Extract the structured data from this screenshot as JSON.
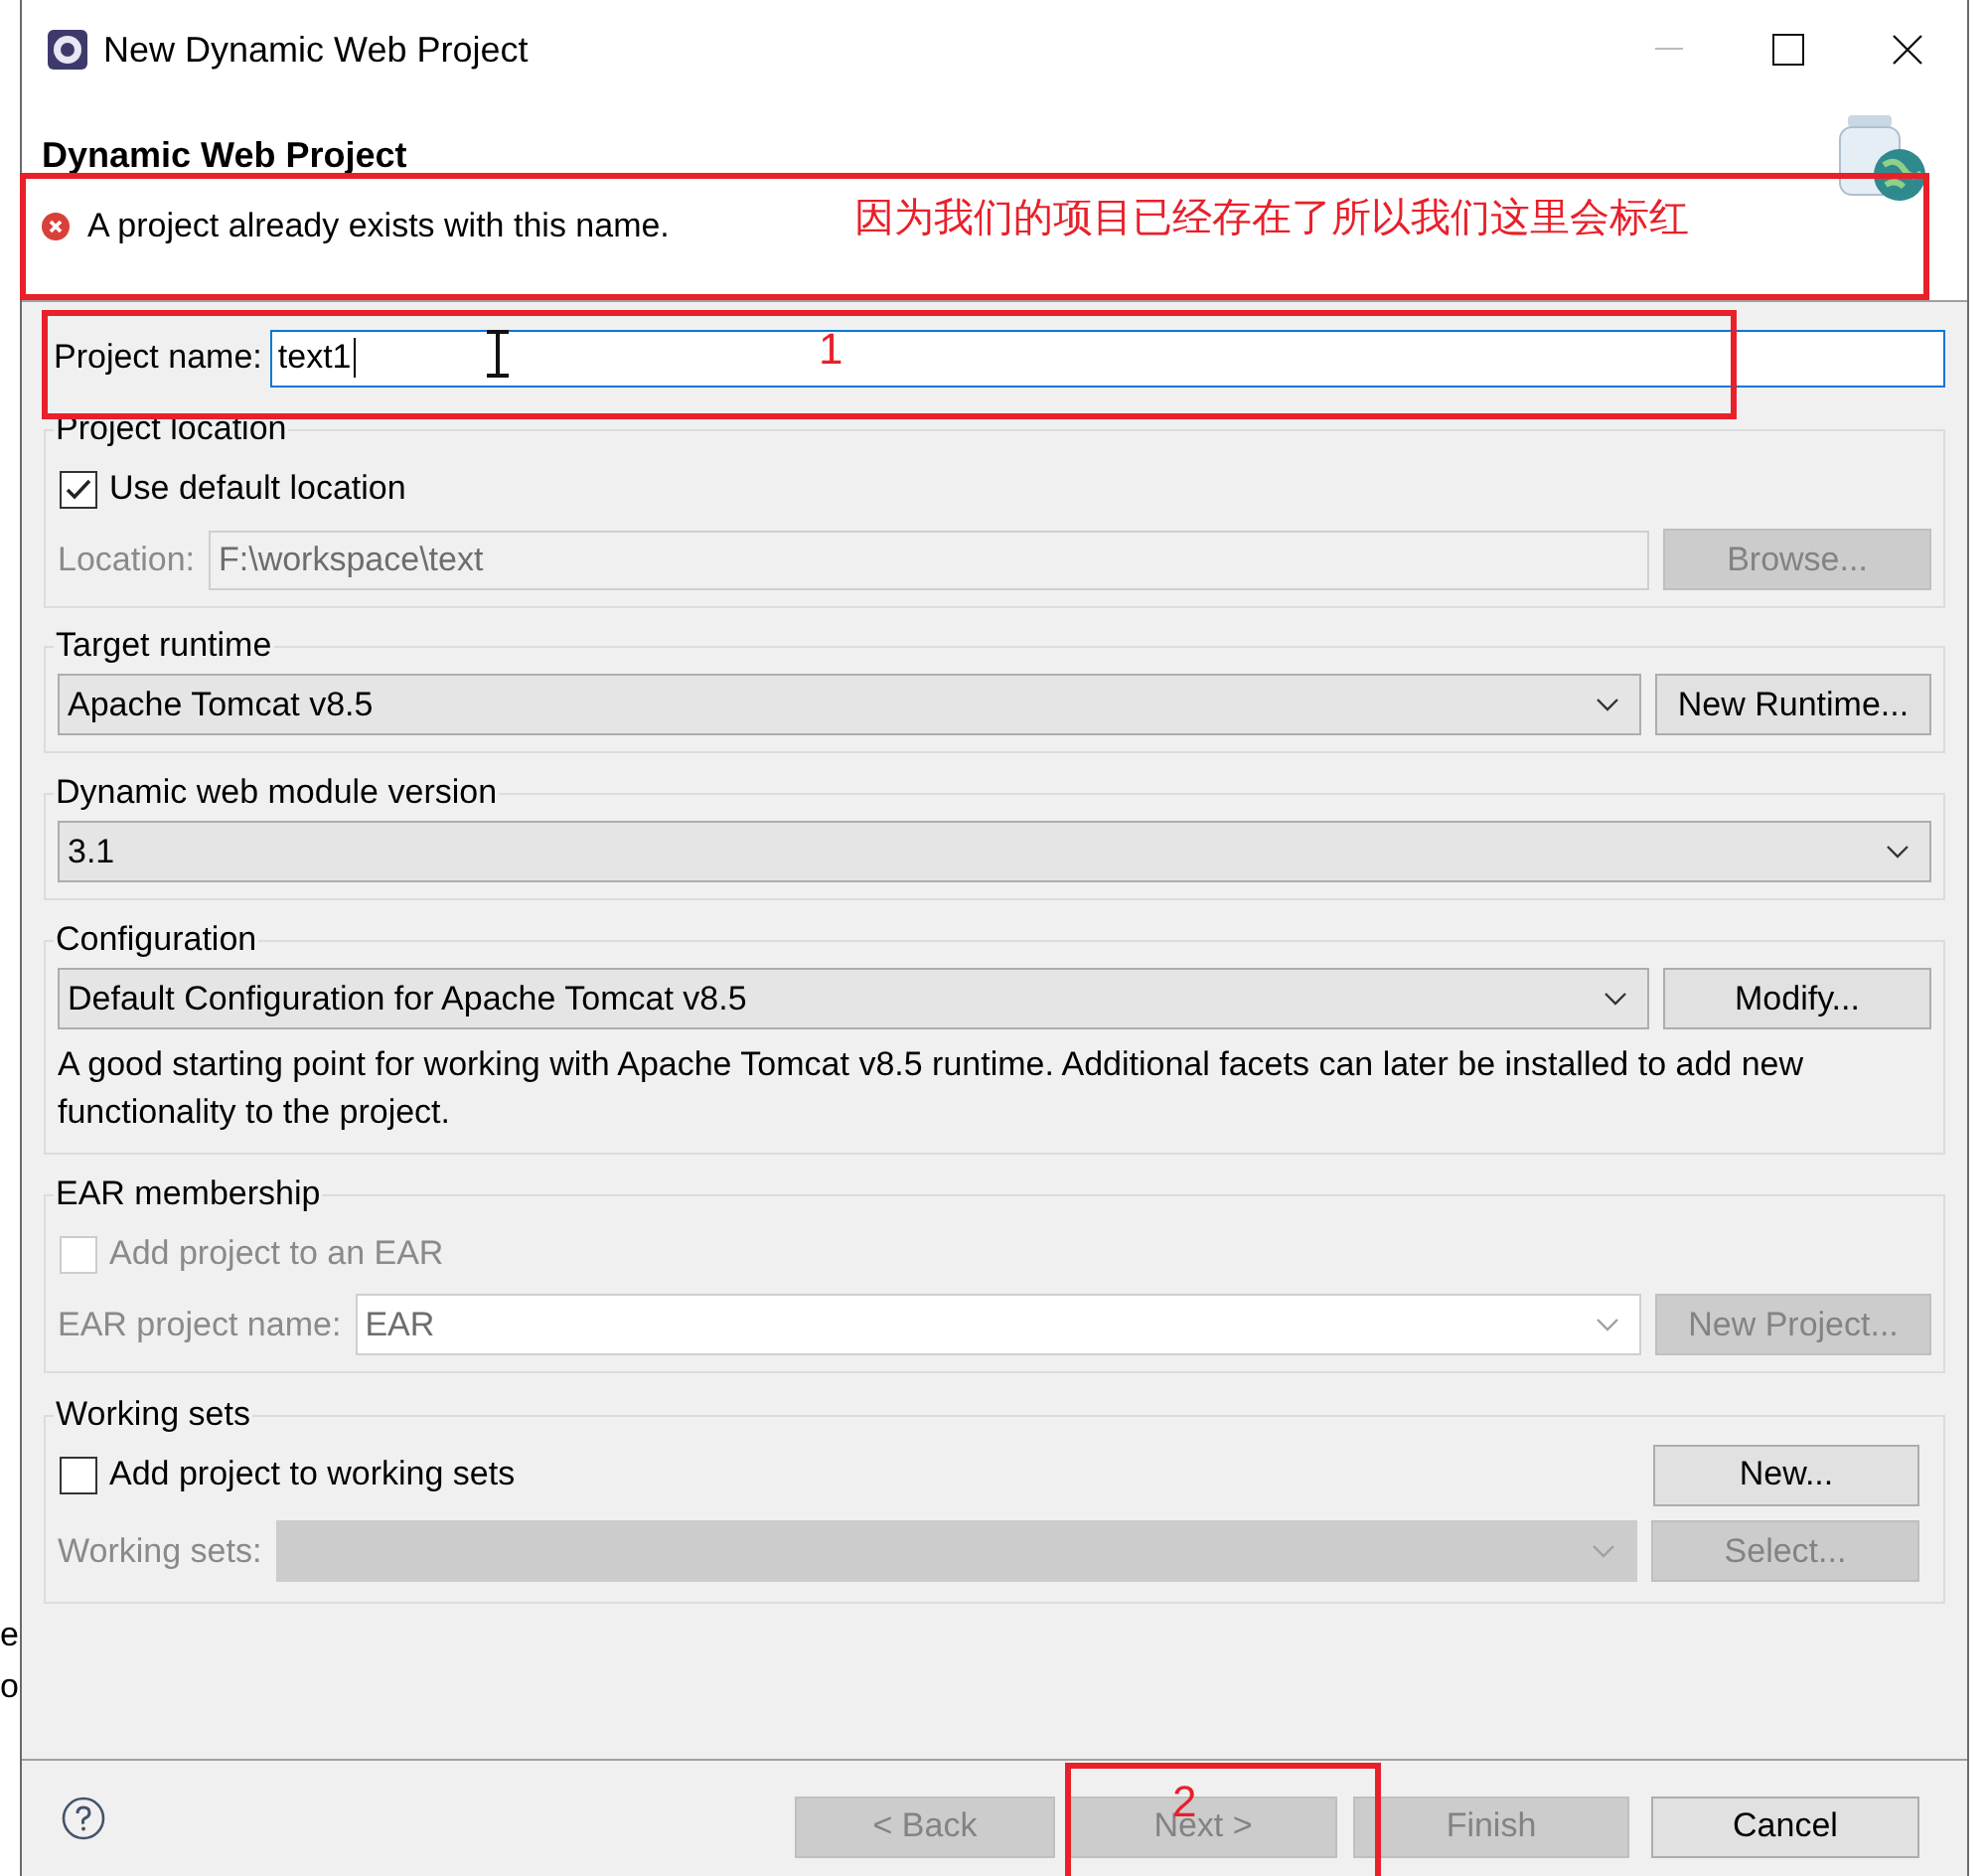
{
  "window": {
    "title": "New Dynamic Web Project"
  },
  "header": {
    "title": "Dynamic Web Project",
    "message": {
      "kind": "error",
      "text": "A project already exists with this name."
    }
  },
  "project_name": {
    "label": "Project name:",
    "value": "text1"
  },
  "sections": [
    {
      "title": "Project location",
      "rows": [
        {
          "kind": "checkbox",
          "label": "Use default location",
          "checked": true,
          "disabled": false
        },
        {
          "kind": "field",
          "label": "Location:",
          "value": "F:\\workspace\\text",
          "disabled": true,
          "button": {
            "label": "Browse...",
            "disabled": true
          }
        }
      ]
    },
    {
      "title": "Target runtime",
      "rows": [
        {
          "kind": "combo",
          "value": "Apache Tomcat v8.5",
          "disabled": false,
          "button": {
            "label": "New Runtime...",
            "disabled": false
          }
        }
      ]
    },
    {
      "title": "Dynamic web module version",
      "rows": [
        {
          "kind": "combo",
          "value": "3.1",
          "disabled": false
        }
      ]
    },
    {
      "title": "Configuration",
      "rows": [
        {
          "kind": "combo",
          "value": "Default Configuration for Apache Tomcat v8.5",
          "disabled": false,
          "button": {
            "label": "Modify...",
            "disabled": false
          }
        },
        {
          "kind": "text",
          "text": "A good starting point for working with Apache Tomcat v8.5 runtime. Additional facets can later be installed to add new functionality to the project."
        }
      ]
    },
    {
      "title": "EAR membership",
      "rows": [
        {
          "kind": "checkbox",
          "label": "Add project to an EAR",
          "checked": false,
          "disabled": true
        },
        {
          "kind": "combo",
          "label": "EAR project name:",
          "value": "EAR",
          "disabled": true,
          "button": {
            "label": "New Project...",
            "disabled": true
          }
        }
      ]
    },
    {
      "title": "Working sets",
      "rows": [
        {
          "kind": "checkbox",
          "label": "Add project to working sets",
          "checked": false,
          "disabled": false,
          "button": {
            "label": "New...",
            "disabled": false
          }
        },
        {
          "kind": "combo",
          "label": "Working sets:",
          "disabled": true,
          "button": {
            "label": "Select...",
            "disabled": true
          }
        }
      ]
    }
  ],
  "buttons": [
    {
      "label": "< Back",
      "disabled": true
    },
    {
      "label": "Next >",
      "disabled": true
    },
    {
      "label": "Finish",
      "disabled": true
    },
    {
      "label": "Cancel",
      "disabled": false
    }
  ],
  "annotations": [
    {
      "text": "因为我们的项目已经存在了所以我们这里会标红"
    },
    {
      "text": "1"
    },
    {
      "text": "2"
    }
  ],
  "background_text": [
    "e",
    "o"
  ]
}
